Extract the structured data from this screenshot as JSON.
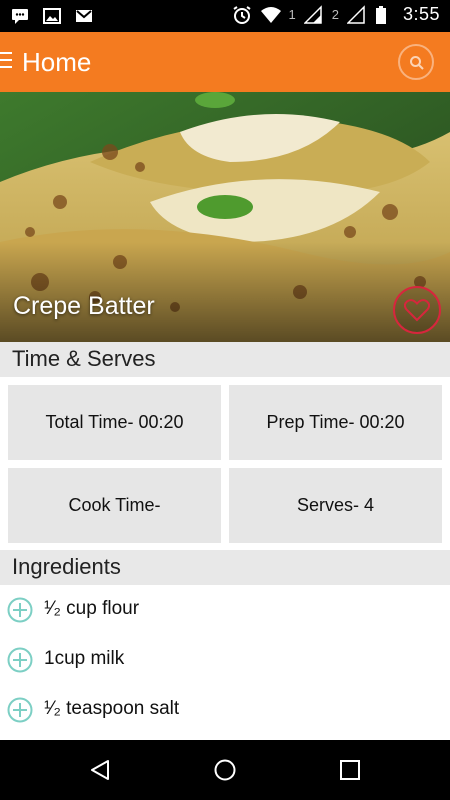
{
  "status_bar": {
    "sim1": "1",
    "sim2": "2",
    "time": "3:55"
  },
  "app_bar": {
    "title": "Home"
  },
  "recipe": {
    "title": "Crepe Batter"
  },
  "time_serves": {
    "header": "Time & Serves",
    "total_time": "Total Time- 00:20",
    "prep_time": "Prep Time- 00:20",
    "cook_time": "Cook Time-",
    "serves": "Serves- 4"
  },
  "ingredients": {
    "header": "Ingredients",
    "items": [
      {
        "text": "¹⁄₂ cup flour"
      },
      {
        "text": "1cup milk"
      },
      {
        "text": "¹⁄₂ teaspoon salt"
      }
    ]
  },
  "colors": {
    "accent": "#f47b20",
    "favorite": "#d7263d",
    "add_icon": "#7ccfc4"
  }
}
